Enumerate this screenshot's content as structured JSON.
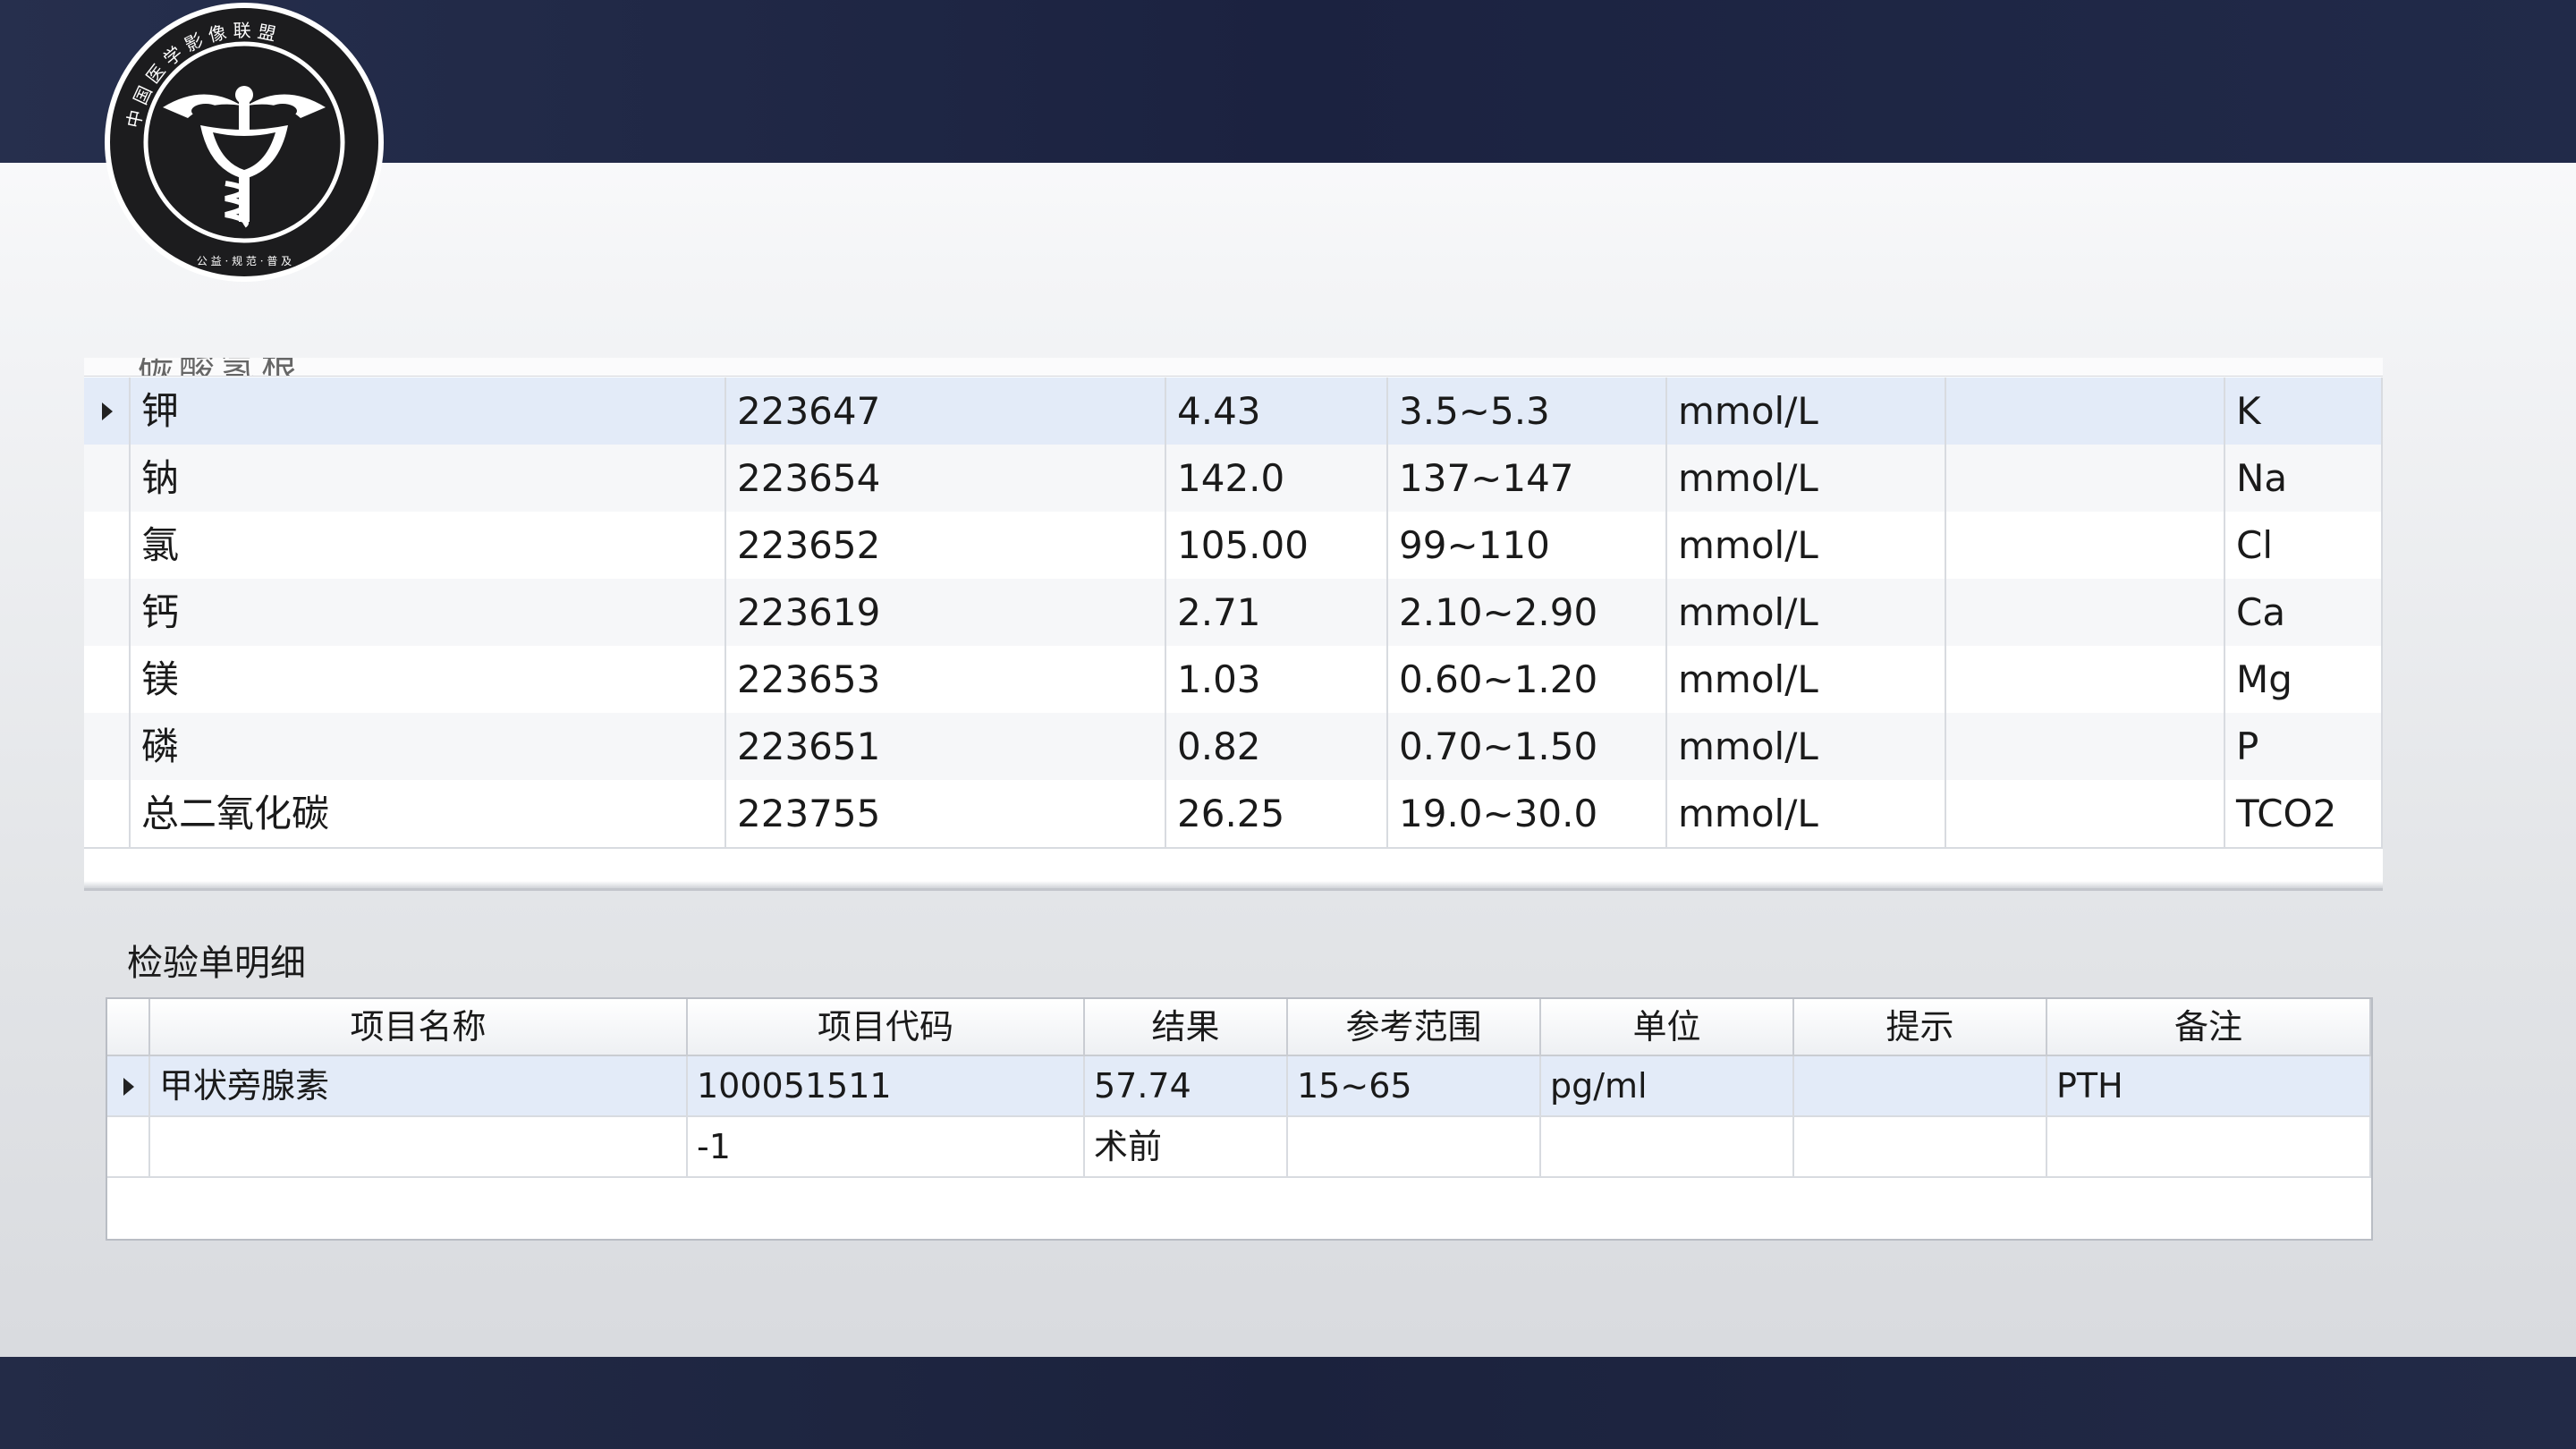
{
  "colors": {
    "header_bg": "#1b2240",
    "selected_row": "#e3ebf8",
    "grid_line": "#d8dbe0"
  },
  "logo": {
    "icon": "caduceus-emblem",
    "ring_text": "中 国 医 学 影 像 联 盟",
    "ring_sub": "公 益 · 规 范 · 普 及"
  },
  "upper_grid": {
    "partial_row_text": "碳酸氢根",
    "rows": [
      {
        "name": "钾",
        "code": "223647",
        "result": "4.43",
        "range": "3.5~5.3",
        "unit": "mmol/L",
        "hint": "",
        "note": "K",
        "selected": true
      },
      {
        "name": "钠",
        "code": "223654",
        "result": "142.0",
        "range": "137~147",
        "unit": "mmol/L",
        "hint": "",
        "note": "Na"
      },
      {
        "name": "氯",
        "code": "223652",
        "result": "105.00",
        "range": "99~110",
        "unit": "mmol/L",
        "hint": "",
        "note": "Cl"
      },
      {
        "name": "钙",
        "code": "223619",
        "result": "2.71",
        "range": "2.10~2.90",
        "unit": "mmol/L",
        "hint": "",
        "note": "Ca"
      },
      {
        "name": "镁",
        "code": "223653",
        "result": "1.03",
        "range": "0.60~1.20",
        "unit": "mmol/L",
        "hint": "",
        "note": "Mg"
      },
      {
        "name": "磷",
        "code": "223651",
        "result": "0.82",
        "range": "0.70~1.50",
        "unit": "mmol/L",
        "hint": "",
        "note": "P"
      },
      {
        "name": "总二氧化碳",
        "code": "223755",
        "result": "26.25",
        "range": "19.0~30.0",
        "unit": "mmol/L",
        "hint": "",
        "note": "TCO2"
      }
    ]
  },
  "lower_panel": {
    "title": "检验单明细",
    "headers": [
      "项目名称",
      "项目代码",
      "结果",
      "参考范围",
      "单位",
      "提示",
      "备注"
    ],
    "rows": [
      {
        "name": "甲状旁腺素",
        "code": "100051511",
        "result": "57.74",
        "range": "15~65",
        "unit": "pg/ml",
        "hint": "",
        "note": "PTH",
        "selected": true
      },
      {
        "name": "",
        "code": "-1",
        "result": "术前",
        "range": "",
        "unit": "",
        "hint": "",
        "note": ""
      }
    ]
  }
}
